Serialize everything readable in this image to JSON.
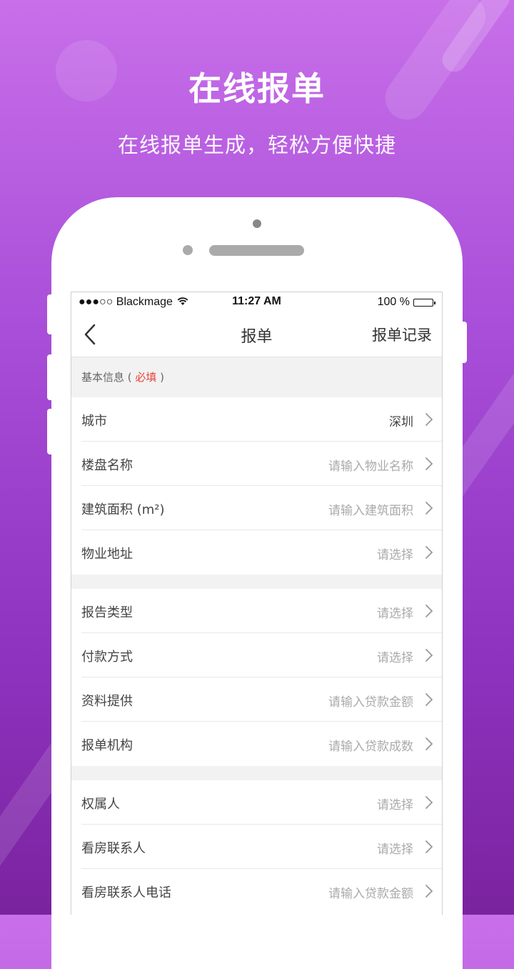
{
  "hero": {
    "title": "在线报单",
    "subtitle": "在线报单生成，轻松方便快捷"
  },
  "status_bar": {
    "carrier": "●●●○○ Blackmage",
    "time": "11:27 AM",
    "battery": "100 %"
  },
  "nav": {
    "title": "报单",
    "records": "报单记录"
  },
  "section": {
    "prefix": "基本信息 ( ",
    "required": "必填",
    "suffix": " )"
  },
  "group1": [
    {
      "label": "城市",
      "value": "深圳"
    },
    {
      "label": "楼盘名称",
      "value": "请输入物业名称"
    },
    {
      "label": "建筑面积 (m²)",
      "value": "请输入建筑面积"
    },
    {
      "label": "物业地址",
      "value": "请选择"
    }
  ],
  "group2": [
    {
      "label": "报告类型",
      "value": "请选择"
    },
    {
      "label": "付款方式",
      "value": "请选择"
    },
    {
      "label": "资料提供",
      "value": "请输入贷款金额"
    },
    {
      "label": "报单机构",
      "value": "请输入贷款成数"
    }
  ],
  "group3": [
    {
      "label": "权属人",
      "value": "请选择"
    },
    {
      "label": "看房联系人",
      "value": "请选择"
    },
    {
      "label": "看房联系人电话",
      "value": "请输入贷款金额"
    }
  ],
  "colors": {
    "accent_red": "#e8443a",
    "bg_top": "#c86fe9",
    "bg_bottom": "#7a239f"
  }
}
